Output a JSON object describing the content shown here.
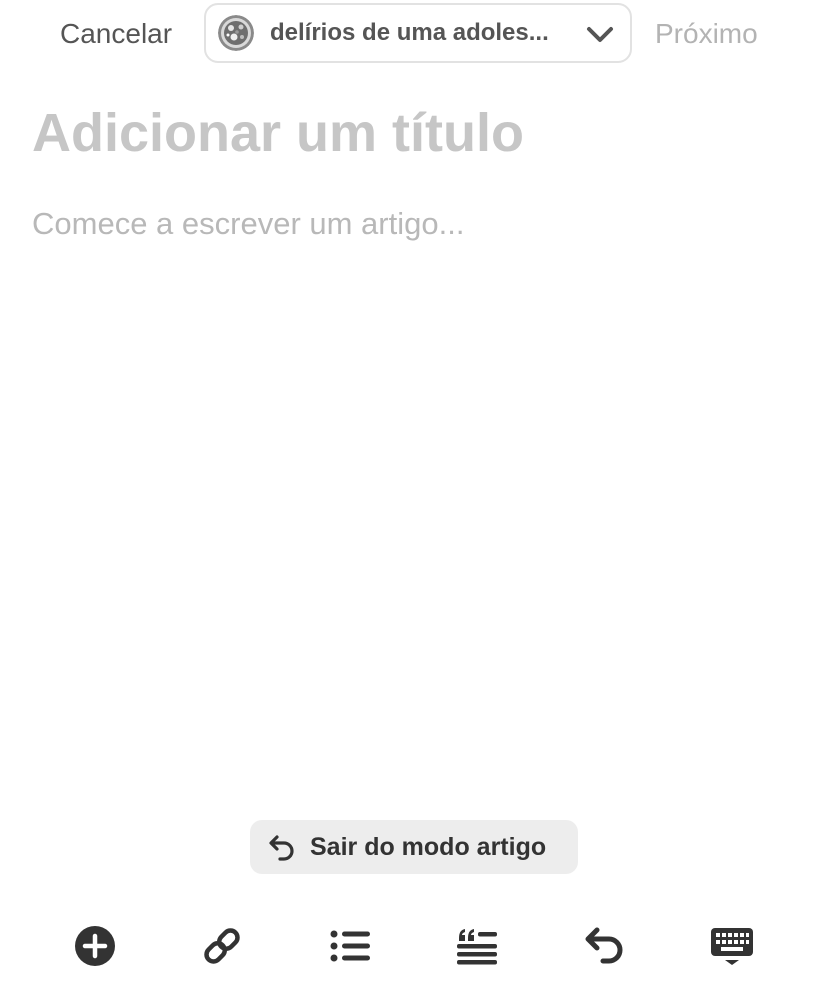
{
  "header": {
    "cancel_label": "Cancelar",
    "blog_selector": {
      "blog_name": "delírios de uma adoles...",
      "avatar_icon": "blog-avatar-icon",
      "dropdown_icon": "chevron-down-icon"
    },
    "next_label": "Próximo"
  },
  "editor": {
    "title_placeholder": "Adicionar um título",
    "body_placeholder": "Comece a escrever um artigo..."
  },
  "exit_article_mode": {
    "label": "Sair do modo artigo",
    "icon": "undo-arrow-icon"
  },
  "toolbar": {
    "items": [
      {
        "icon": "add-circle-icon"
      },
      {
        "icon": "link-icon"
      },
      {
        "icon": "bulleted-list-icon"
      },
      {
        "icon": "quote-icon"
      },
      {
        "icon": "undo-icon"
      },
      {
        "icon": "keyboard-hide-icon"
      }
    ]
  },
  "colors": {
    "text_dark": "#333333",
    "text_medium": "#555555",
    "placeholder_title": "#c6c6c6",
    "placeholder_body": "#b8b8b8",
    "next_disabled": "#b3b3b3",
    "pill_background": "#ededed",
    "selector_border": "#e2e2e2"
  }
}
